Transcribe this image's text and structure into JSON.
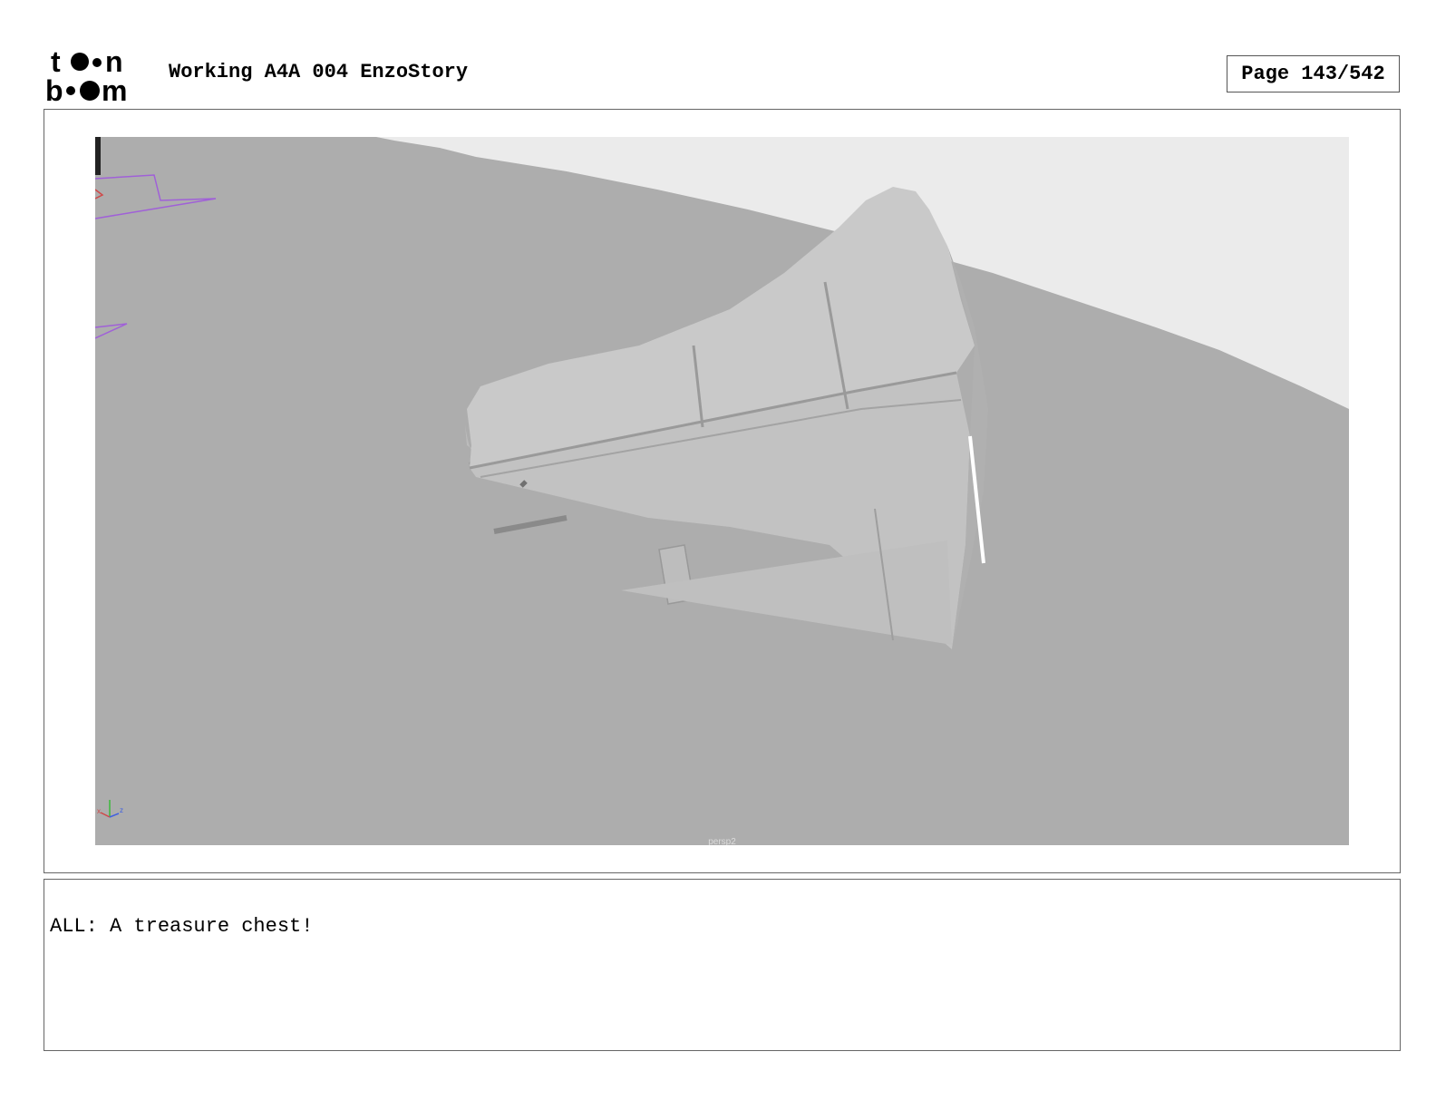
{
  "header": {
    "logo_text": "toon boom",
    "document_title": "Working A4A 004 EnzoStory",
    "page_indicator": "Page 143/542"
  },
  "panel": {
    "camera_label": "persp2",
    "axis_gizmo_labels": [
      "x",
      "z"
    ],
    "colors": {
      "ground": "#adadad",
      "sky": "#ebebeb",
      "chest": "#c6c6c6",
      "curve": "#a060d8"
    }
  },
  "notes": {
    "dialogue": "ALL: A treasure chest!"
  }
}
